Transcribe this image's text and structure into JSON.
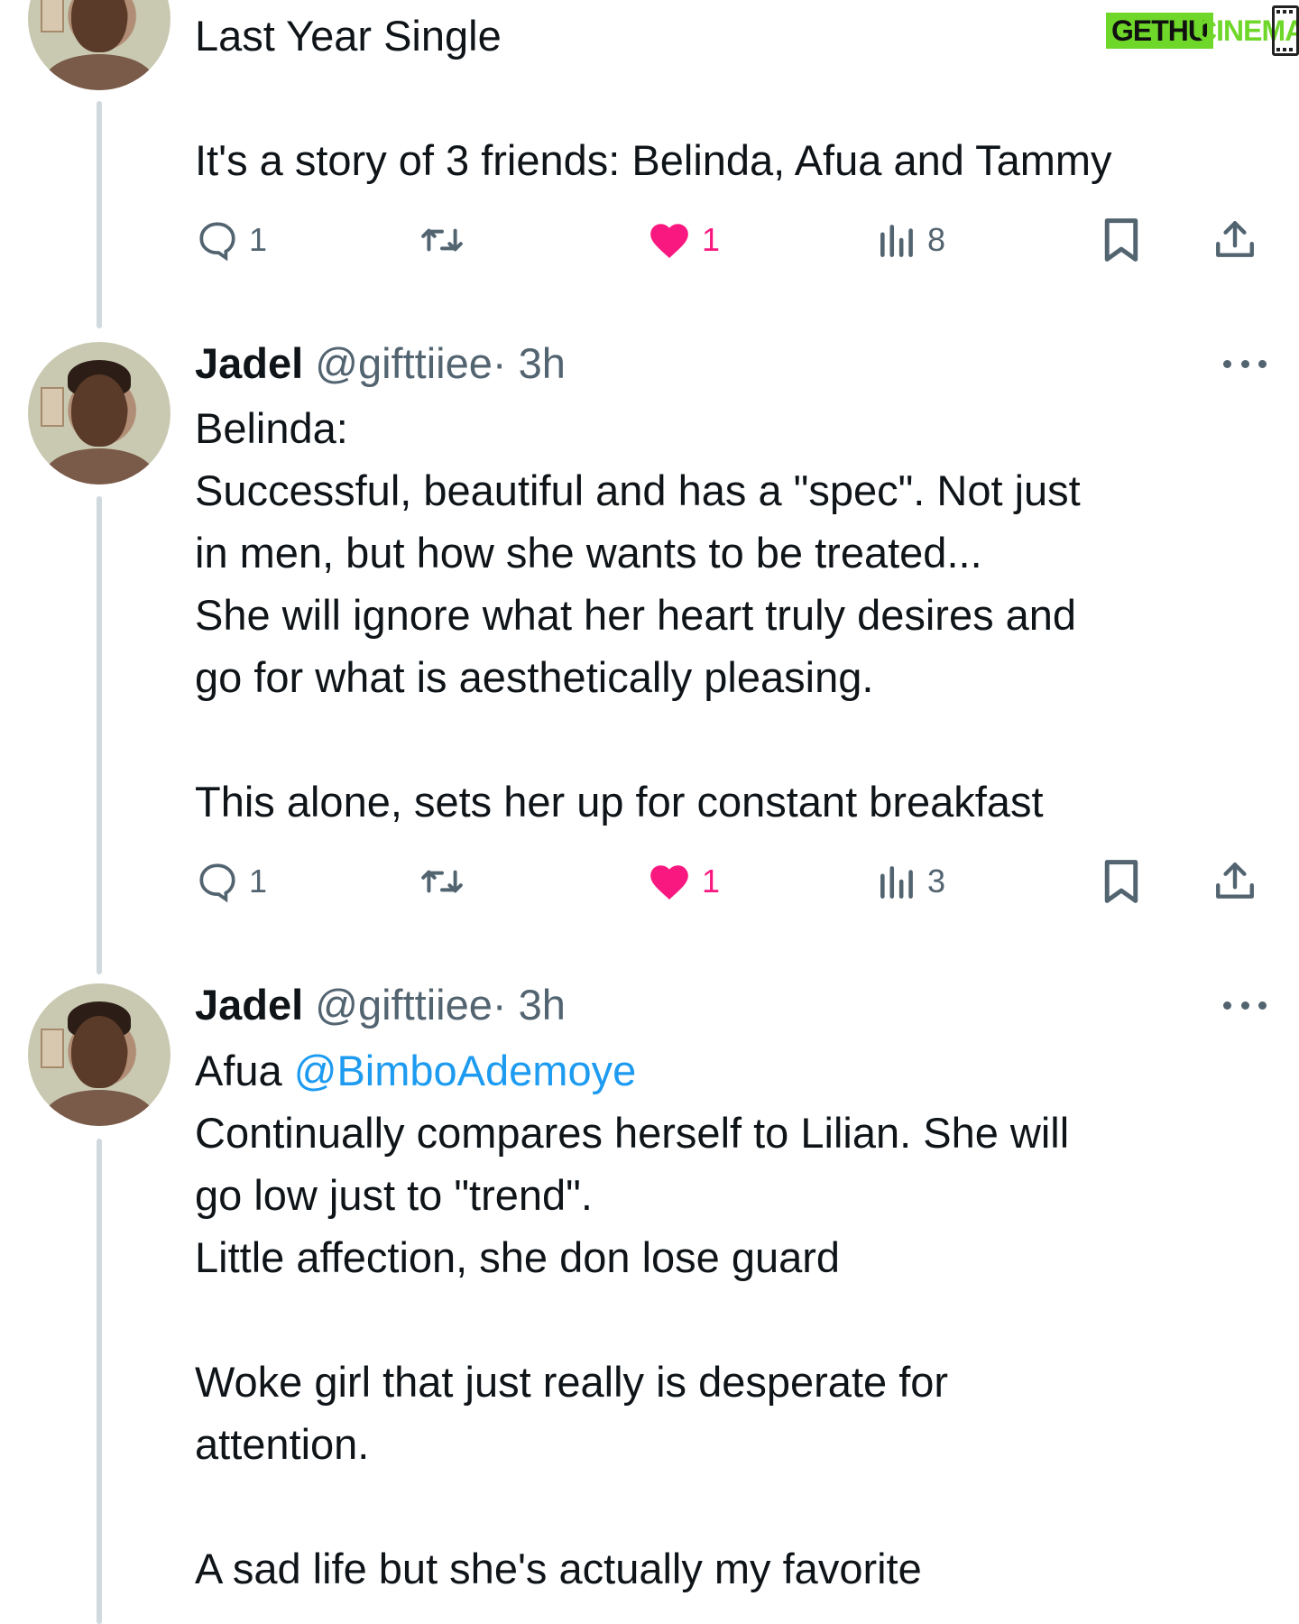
{
  "watermark": {
    "part1": "GETHU",
    "part2": "CINEMA"
  },
  "tweets": [
    {
      "lines": [
        "Last Year Single",
        "",
        "It's a story of 3 friends: Belinda, Afua and Tammy"
      ],
      "replies": "1",
      "retweets": "",
      "likes": "1",
      "views": "8"
    },
    {
      "name": "Jadel",
      "handle": "@gifttiiee",
      "time": "· 3h",
      "lines": [
        "Belinda:",
        "Successful, beautiful and has a \"spec\". Not just",
        "in men, but how she wants to be treated...",
        "She will ignore what her heart truly desires and",
        "go for what is aesthetically pleasing.",
        "",
        "This alone, sets her up for constant breakfast"
      ],
      "replies": "1",
      "retweets": "",
      "likes": "1",
      "views": "3"
    },
    {
      "name": "Jadel",
      "handle": "@gifttiiee",
      "time": "· 3h",
      "first_word": "Afua ",
      "mention": "@BimboAdemoye",
      "lines": [
        "Continually compares herself to Lilian. She will",
        "go low just to \"trend\".",
        "Little affection, she don lose guard",
        "",
        "Woke girl that just really is desperate for",
        "attention.",
        "",
        "A sad life but she's actually my favorite"
      ]
    }
  ],
  "colors": {
    "text": "#0f1419",
    "secondary": "#536471",
    "like": "#f91880",
    "link": "#1d9bf0",
    "thread_line": "#cfd9de",
    "watermark_green": "#6fd72a"
  },
  "icons": [
    "reply-icon",
    "retweet-icon",
    "heart-icon",
    "views-icon",
    "bookmark-icon",
    "share-icon",
    "more-icon"
  ]
}
